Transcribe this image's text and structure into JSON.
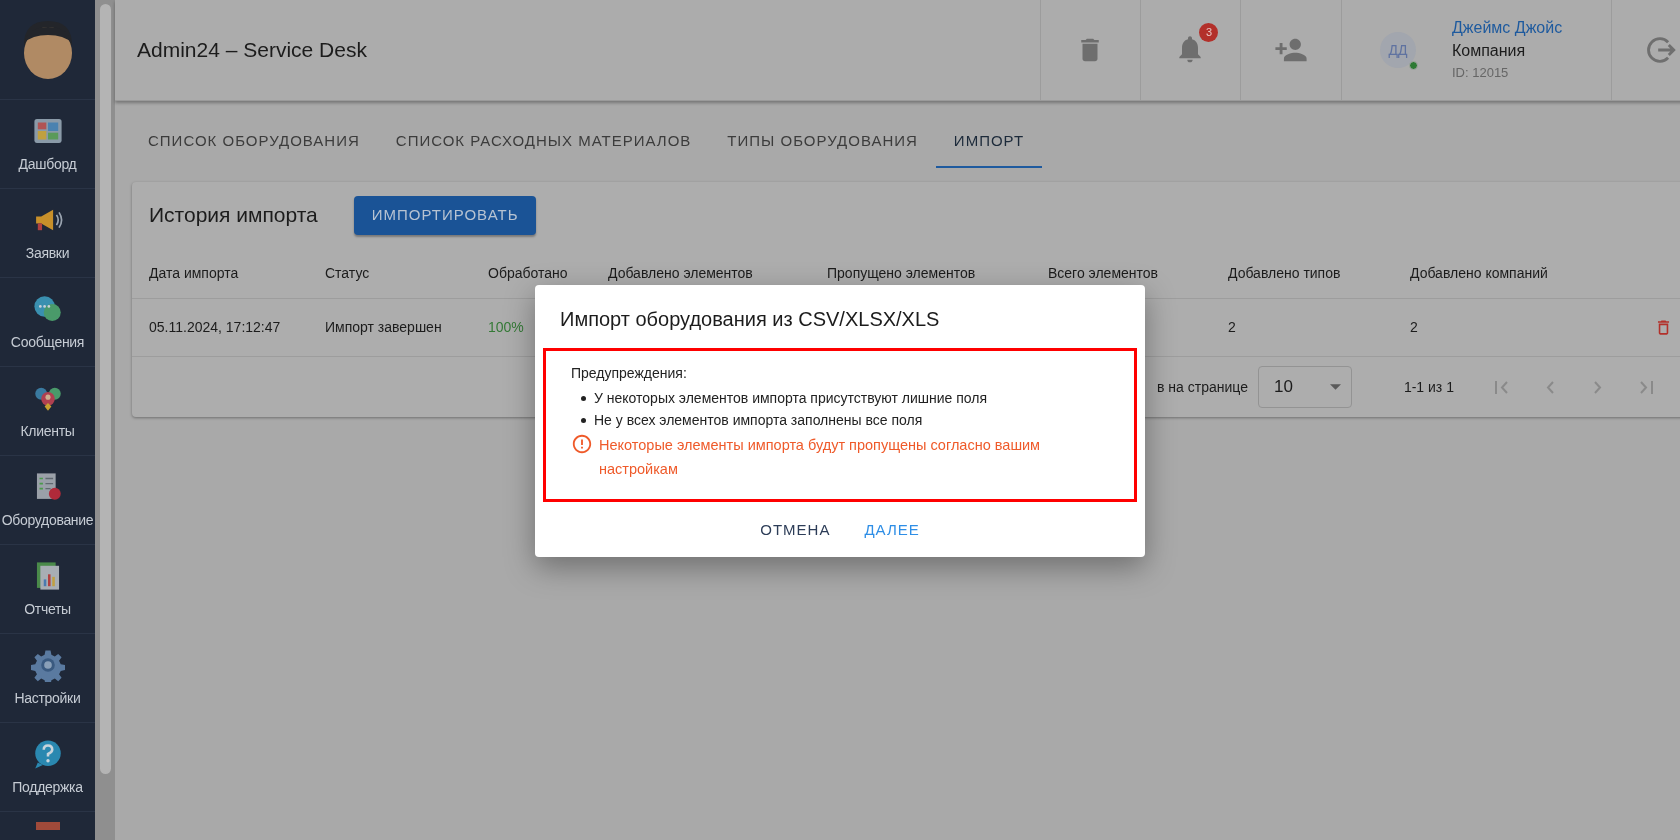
{
  "sidebar": {
    "items": [
      {
        "label": "Дашборд"
      },
      {
        "label": "Заявки"
      },
      {
        "label": "Сообщения"
      },
      {
        "label": "Клиенты"
      },
      {
        "label": "Оборудование"
      },
      {
        "label": "Отчеты"
      },
      {
        "label": "Настройки"
      },
      {
        "label": "Поддержка"
      }
    ]
  },
  "header": {
    "title": "Admin24 – Service Desk",
    "notifications_badge": "3",
    "user": {
      "initials": "ДД",
      "online": true,
      "name": "Джеймс Джойс",
      "company": "Компания",
      "id": "ID: 12015"
    }
  },
  "tabs": [
    {
      "label": "СПИСОК ОБОРУДОВАНИЯ",
      "selected": false
    },
    {
      "label": "СПИСОК РАСХОДНЫХ МАТЕРИАЛОВ",
      "selected": false
    },
    {
      "label": "ТИПЫ ОБОРУДОВАНИЯ",
      "selected": false
    },
    {
      "label": "ИМПОРТ",
      "selected": true
    }
  ],
  "import_history": {
    "title": "История импорта",
    "import_button": "ИМПОРТИРОВАТЬ",
    "columns": [
      "Дата импорта",
      "Статус",
      "Обработано",
      "Добавлено элементов",
      "Пропущено элементов",
      "Всего элементов",
      "Добавлено типов",
      "Добавлено компаний"
    ],
    "rows": [
      {
        "date": "05.11.2024, 17:12:47",
        "status": "Импорт завершен",
        "processed": "100%",
        "types_added": "2",
        "companies_added": "2"
      }
    ],
    "pagination": {
      "rows_per_page_label": "в на странице",
      "rows_per_page": "10",
      "range": "1-1 из 1"
    }
  },
  "dialog": {
    "title": "Импорт оборудования из CSV/XLSX/XLS",
    "warnings_heading": "Предупреждения:",
    "warnings": [
      "У некоторых элементов импорта присутствуют лишние поля",
      "Не у всех элементов импорта заполнены все поля"
    ],
    "notice": "Некоторые элементы импорта будут пропущены согласно вашим настройкам",
    "buttons": [
      {
        "label": "ОТМЕНА",
        "kind": "cancel"
      },
      {
        "label": "ДАЛЕЕ",
        "kind": "primary"
      }
    ]
  }
}
